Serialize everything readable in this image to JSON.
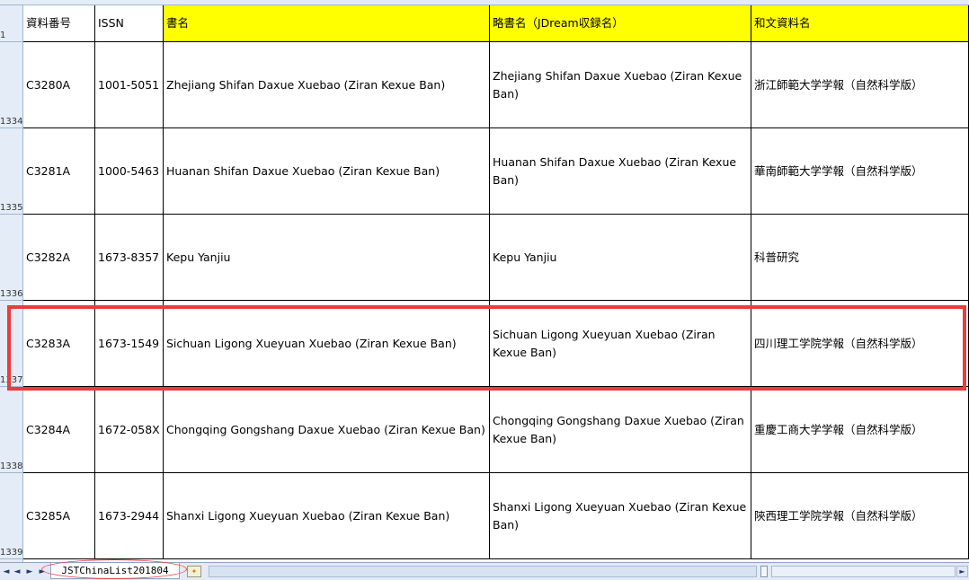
{
  "window": {
    "title": "JSTChinaList201804"
  },
  "columns": {
    "headers": [
      "資料番号",
      "ISSN",
      "書名",
      "略書名（JDream収録名）",
      "和文資料名"
    ],
    "header_row_number": "1"
  },
  "rows": [
    {
      "row_number": "1334",
      "id": "C3280A",
      "issn": "1001-5051",
      "title": "Zhejiang Shifan Daxue Xuebao (Ziran Kexue Ban)",
      "abbr": "Zhejiang Shifan Daxue Xuebao (Ziran Kexue Ban)",
      "japanese": "浙江師範大学学報（自然科学版）"
    },
    {
      "row_number": "1335",
      "id": "C3281A",
      "issn": "1000-5463",
      "title": "Huanan Shifan Daxue Xuebao (Ziran Kexue Ban)",
      "abbr": "Huanan Shifan Daxue Xuebao (Ziran Kexue Ban)",
      "japanese": "華南師範大学学報（自然科学版）"
    },
    {
      "row_number": "1336",
      "id": "C3282A",
      "issn": "1673-8357",
      "title": "Kepu Yanjiu",
      "abbr": "Kepu Yanjiu",
      "japanese": "科普研究"
    },
    {
      "row_number": "1337",
      "id": "C3283A",
      "issn": "1673-1549",
      "title": "Sichuan Ligong Xueyuan Xuebao (Ziran Kexue Ban)",
      "abbr": "Sichuan Ligong Xueyuan Xuebao (Ziran Kexue Ban)",
      "japanese": "四川理工学院学報（自然科学版）"
    },
    {
      "row_number": "1338",
      "id": "C3284A",
      "issn": "1672-058X",
      "title": "Chongqing Gongshang Daxue Xuebao (Ziran Kexue Ban)",
      "abbr": "Chongqing Gongshang Daxue Xuebao (Ziran Kexue Ban)",
      "japanese": "重慶工商大学学報（自然科学版）"
    },
    {
      "row_number": "1339",
      "id": "C3285A",
      "issn": "1673-2944",
      "title": "Shanxi Ligong Xueyuan Xuebao (Ziran Kexue Ban)",
      "abbr": "Shanxi Ligong Xueyuan Xuebao (Ziran Kexue Ban)",
      "japanese": "陝西理工学院学報（自然科学版）"
    }
  ],
  "highlighted_row": "1337",
  "tabbar": {
    "sheet_tab": "JSTChinaList201804",
    "nav_first": "◄",
    "nav_prev": "◄",
    "nav_next": "►",
    "nav_last": "►"
  },
  "colors": {
    "header_yellow": "#ffff00",
    "highlight_red": "#ee3a3a",
    "chrome_blue": "#e4ecf7"
  }
}
